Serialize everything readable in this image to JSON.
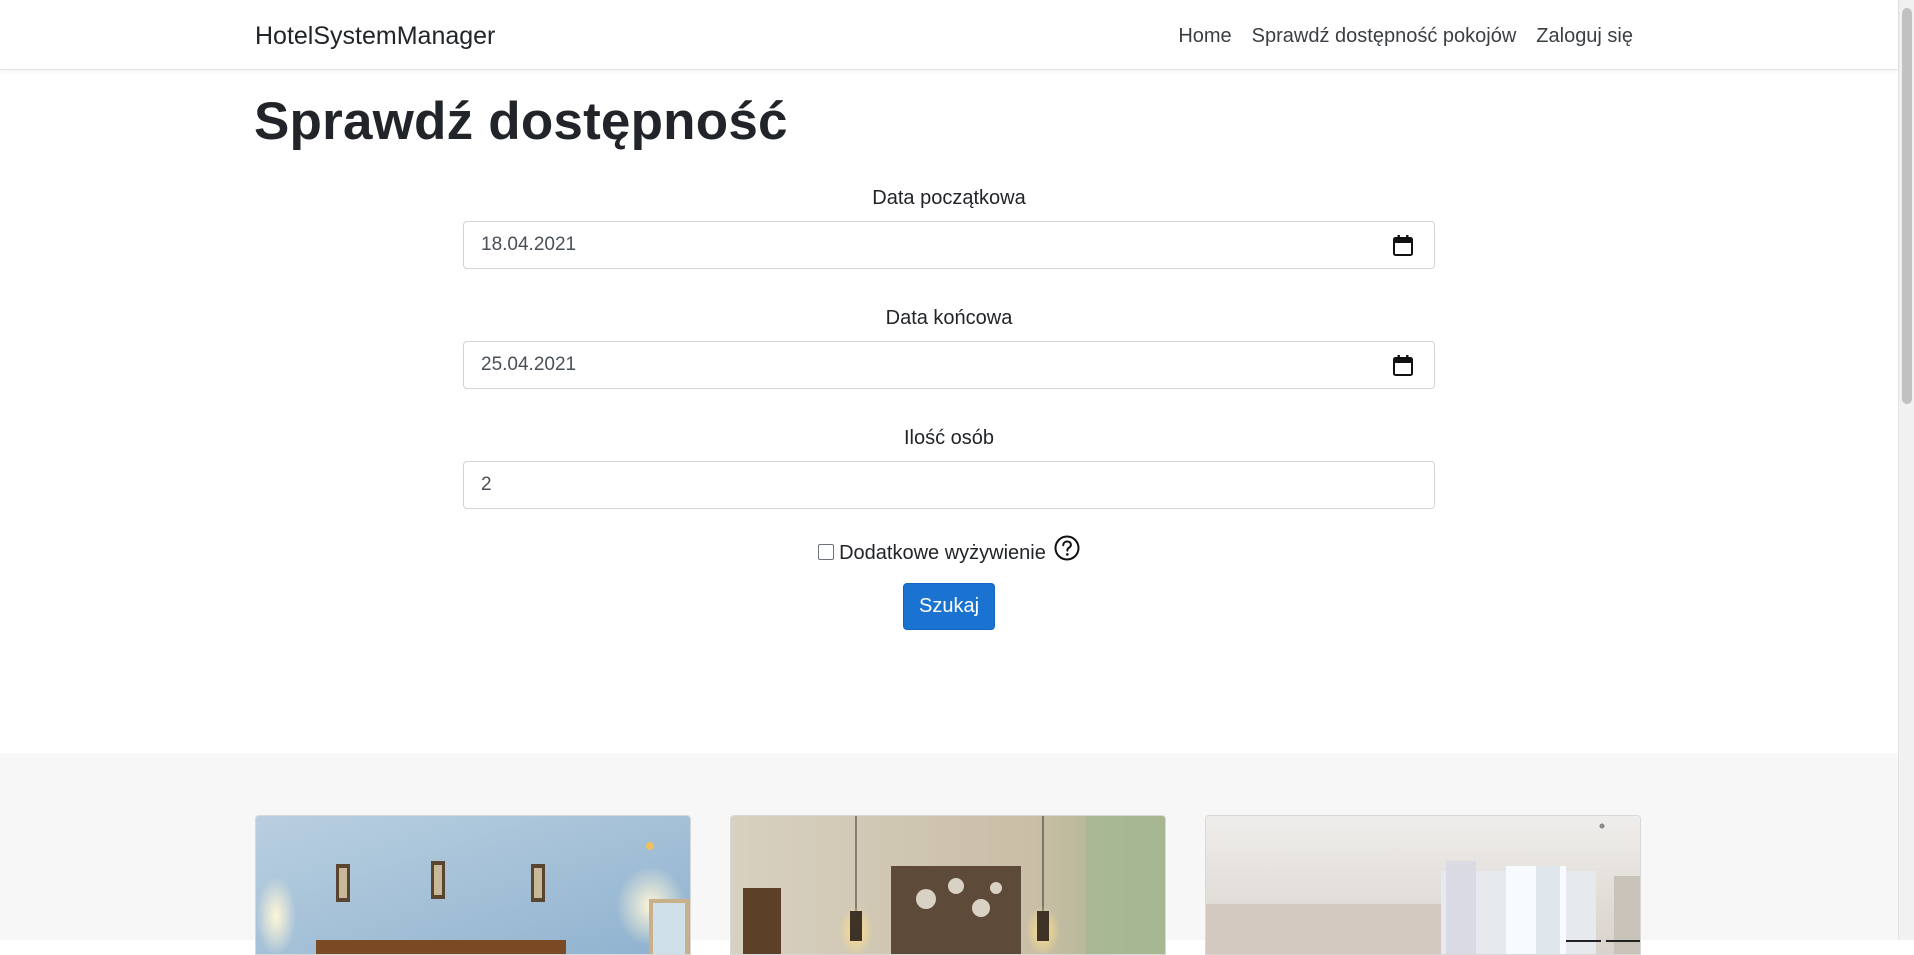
{
  "navbar": {
    "brand": "HotelSystemManager",
    "links": [
      "Home",
      "Sprawdź dostępność pokojów",
      "Zaloguj się"
    ]
  },
  "main": {
    "title": "Sprawdź dostępność",
    "start_date": {
      "label": "Data początkowa",
      "value": "18.04.2021"
    },
    "end_date": {
      "label": "Data końcowa",
      "value": "25.04.2021"
    },
    "guests": {
      "label": "Ilość osób",
      "value": "2"
    },
    "extra_board": {
      "label": "Dodatkowe wyżywienie",
      "checked": false
    },
    "search_button": "Szukaj"
  },
  "colors": {
    "button": "#1a73d1",
    "rooms_background": "#f7f7f8"
  },
  "icons": {
    "date": "calendar-icon",
    "help": "question-circle-icon"
  }
}
